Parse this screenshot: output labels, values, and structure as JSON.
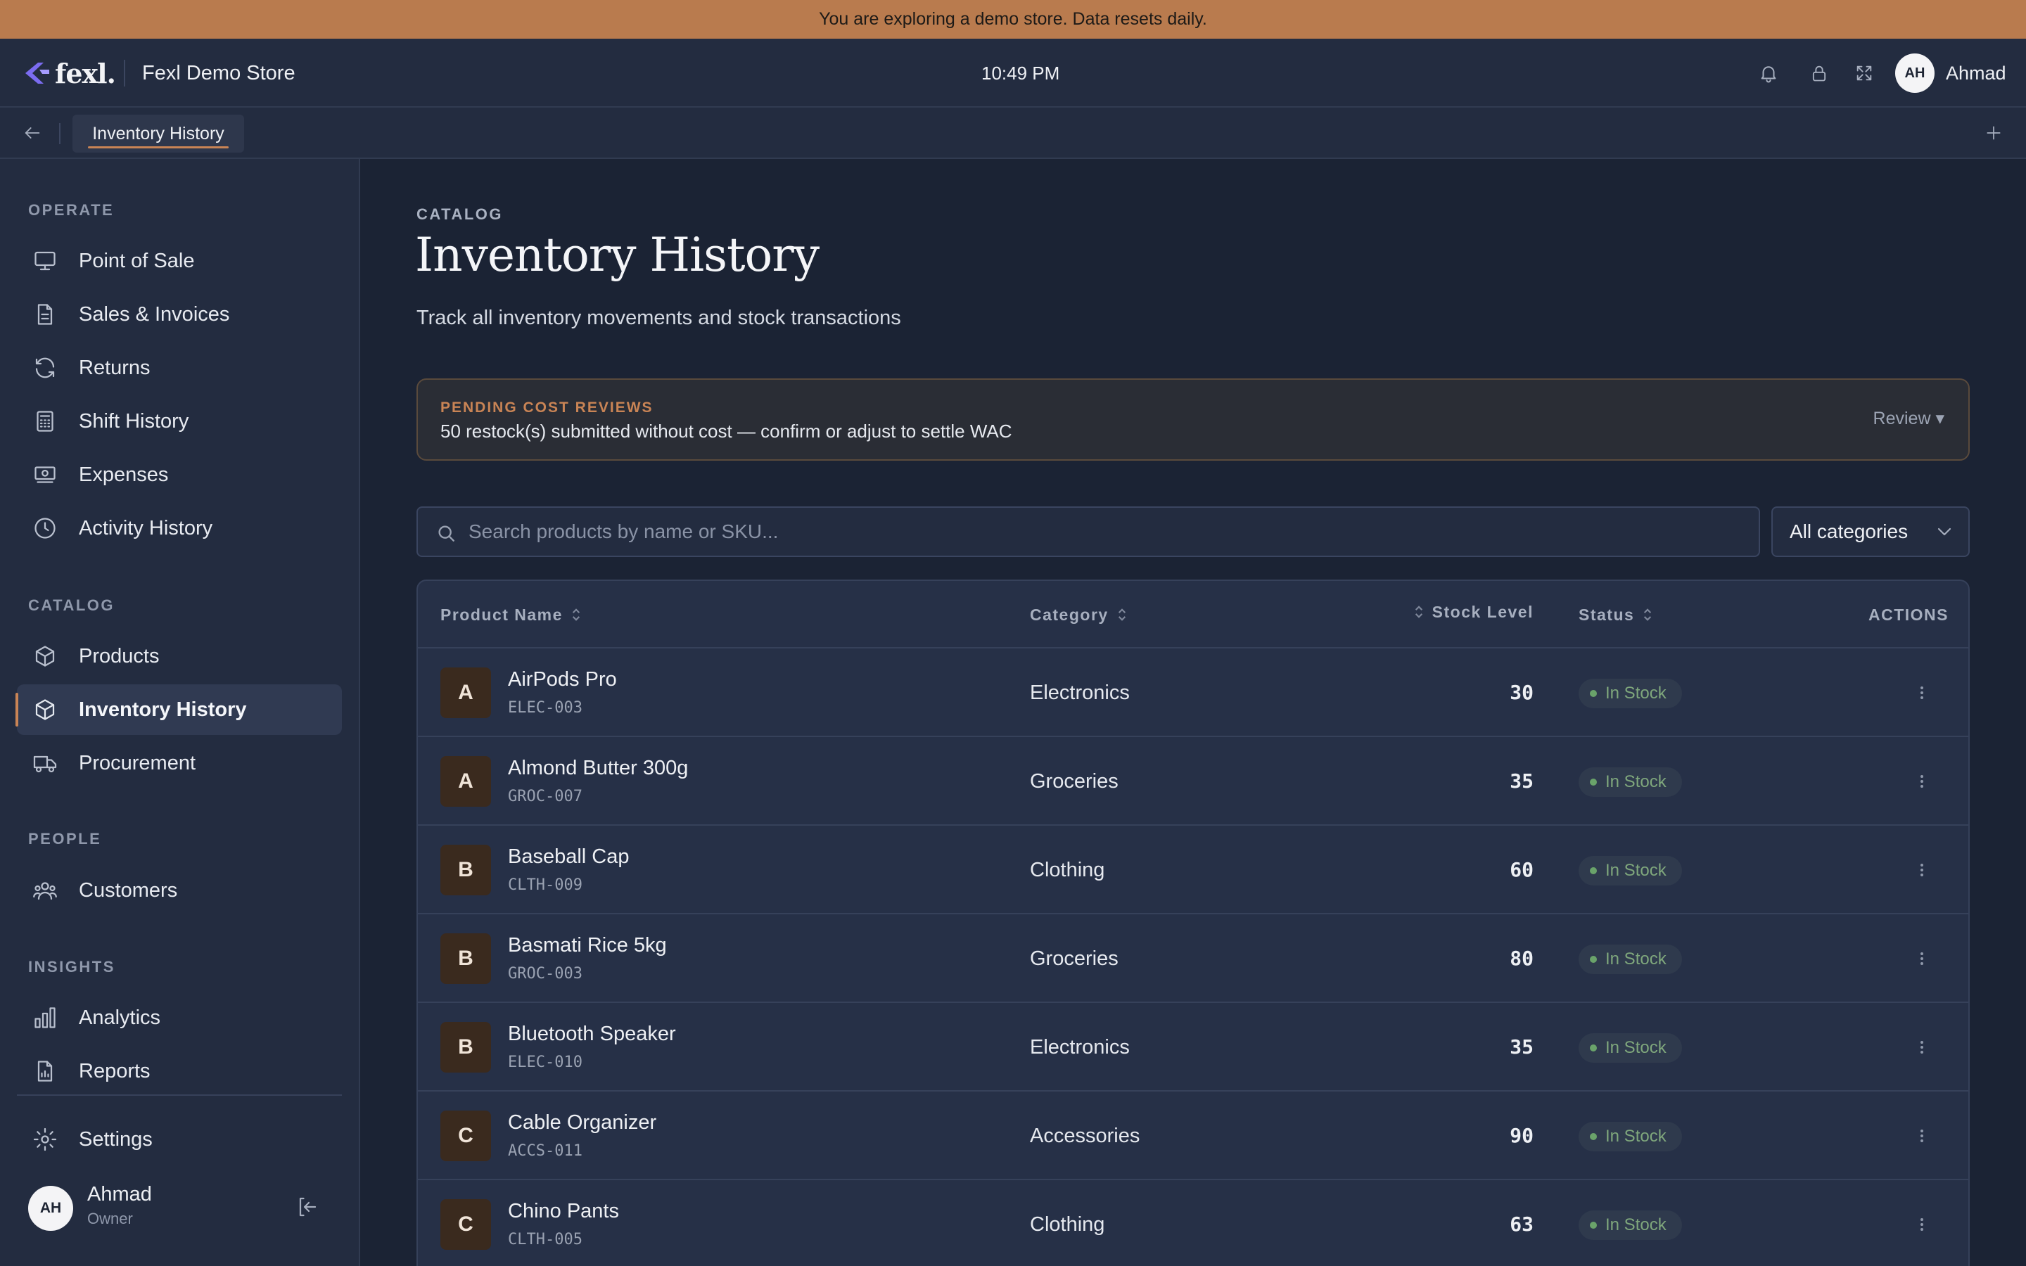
{
  "banner": {
    "text": "You are exploring a demo store. Data resets daily."
  },
  "header": {
    "logo_text": "fexl.",
    "store_name": "Fexl Demo Store",
    "time": "10:49 PM",
    "icons": [
      "bell-icon",
      "lock-icon",
      "fullscreen-icon"
    ],
    "user_initials": "AH",
    "user_name": "Ahmad"
  },
  "tabs": {
    "items": [
      {
        "label": "Inventory History"
      }
    ]
  },
  "sidebar": {
    "sections": [
      {
        "label": "OPERATE",
        "items": [
          {
            "label": "Point of Sale",
            "icon": "monitor-icon"
          },
          {
            "label": "Sales & Invoices",
            "icon": "document-icon"
          },
          {
            "label": "Returns",
            "icon": "refresh-icon"
          },
          {
            "label": "Shift History",
            "icon": "calculator-icon"
          },
          {
            "label": "Expenses",
            "icon": "cash-icon"
          },
          {
            "label": "Activity History",
            "icon": "clock-icon"
          }
        ]
      },
      {
        "label": "CATALOG",
        "items": [
          {
            "label": "Products",
            "icon": "box-icon"
          },
          {
            "label": "Inventory History",
            "icon": "box-icon",
            "active": true
          },
          {
            "label": "Procurement",
            "icon": "truck-icon"
          }
        ]
      },
      {
        "label": "PEOPLE",
        "items": [
          {
            "label": "Customers",
            "icon": "users-icon"
          }
        ]
      },
      {
        "label": "INSIGHTS",
        "items": [
          {
            "label": "Analytics",
            "icon": "bar-chart-icon"
          },
          {
            "label": "Reports",
            "icon": "report-icon"
          }
        ]
      }
    ],
    "settings_label": "Settings",
    "user": {
      "initials": "AH",
      "name": "Ahmad",
      "role": "Owner"
    }
  },
  "page": {
    "breadcrumb": "CATALOG",
    "title": "Inventory History",
    "subtitle": "Track all inventory movements and stock transactions"
  },
  "alert": {
    "title": "PENDING COST REVIEWS",
    "text": "50 restock(s) submitted without cost — confirm or adjust to settle WAC",
    "action": "Review ▾"
  },
  "filters": {
    "search_placeholder": "Search products by name or SKU...",
    "search_value": "",
    "category": "All categories"
  },
  "table": {
    "columns": {
      "name": "Product Name",
      "category": "Category",
      "stock": "Stock Level",
      "status": "Status",
      "actions": "ACTIONS"
    },
    "rows": [
      {
        "initial": "A",
        "name": "AirPods Pro",
        "sku": "ELEC-003",
        "category": "Electronics",
        "stock": "30",
        "status": "In Stock"
      },
      {
        "initial": "A",
        "name": "Almond Butter 300g",
        "sku": "GROC-007",
        "category": "Groceries",
        "stock": "35",
        "status": "In Stock"
      },
      {
        "initial": "B",
        "name": "Baseball Cap",
        "sku": "CLTH-009",
        "category": "Clothing",
        "stock": "60",
        "status": "In Stock"
      },
      {
        "initial": "B",
        "name": "Basmati Rice 5kg",
        "sku": "GROC-003",
        "category": "Groceries",
        "stock": "80",
        "status": "In Stock"
      },
      {
        "initial": "B",
        "name": "Bluetooth Speaker",
        "sku": "ELEC-010",
        "category": "Electronics",
        "stock": "35",
        "status": "In Stock"
      },
      {
        "initial": "C",
        "name": "Cable Organizer",
        "sku": "ACCS-011",
        "category": "Accessories",
        "stock": "90",
        "status": "In Stock"
      },
      {
        "initial": "C",
        "name": "Chino Pants",
        "sku": "CLTH-005",
        "category": "Clothing",
        "stock": "63",
        "status": "In Stock"
      }
    ]
  },
  "colors": {
    "accent": "#c98455",
    "banner": "#b97b4e",
    "status_ok": "#7fa77c"
  }
}
